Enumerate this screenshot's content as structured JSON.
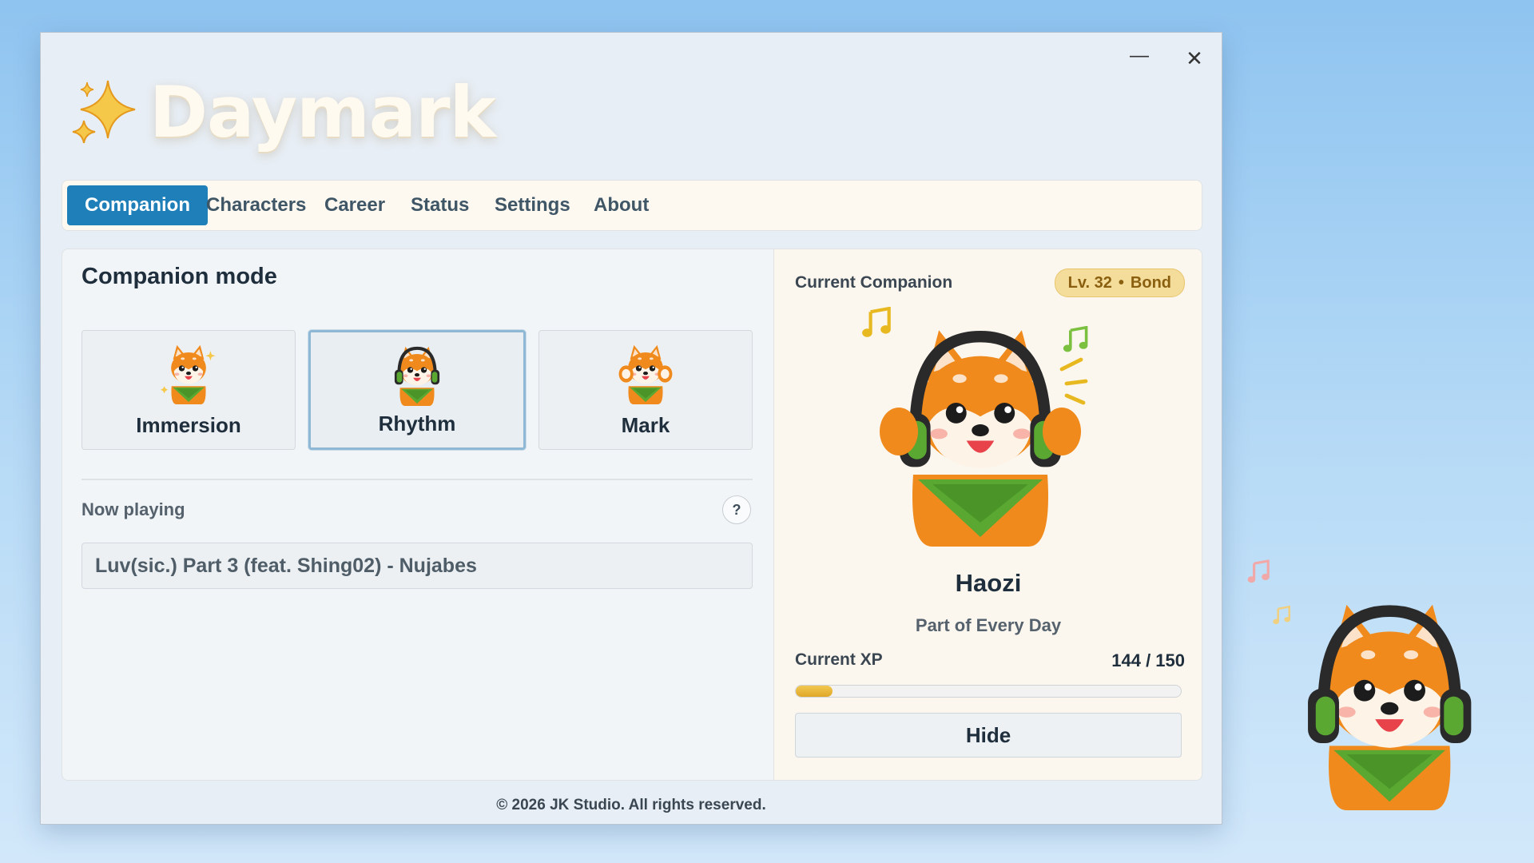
{
  "app": {
    "name": "Daymark"
  },
  "window_controls": {
    "minimize": "—",
    "close": "✕"
  },
  "tabs": [
    {
      "label": "Companion",
      "active": true
    },
    {
      "label": "Characters",
      "active": false
    },
    {
      "label": "Career",
      "active": false
    },
    {
      "label": "Status",
      "active": false
    },
    {
      "label": "Settings",
      "active": false
    },
    {
      "label": "About",
      "active": false
    }
  ],
  "companion_mode": {
    "title": "Companion mode",
    "modes": [
      {
        "label": "Immersion",
        "icon": "shiba-cheer-icon",
        "selected": false
      },
      {
        "label": "Rhythm",
        "icon": "shiba-headphones-icon",
        "selected": true
      },
      {
        "label": "Mark",
        "icon": "shiba-paws-icon",
        "selected": false
      }
    ],
    "now_playing": {
      "label": "Now playing",
      "help": "?",
      "value": "Luv(sic.) Part 3 (feat. Shing02) - Nujabes"
    }
  },
  "current_companion": {
    "label": "Current Companion",
    "level": "Lv. 32",
    "bond": "Bond",
    "name": "Haozi",
    "subtitle": "Part of Every Day",
    "xp_label": "Current XP",
    "xp_text": "144 / 150",
    "xp_fraction": 0.096,
    "hide_label": "Hide"
  },
  "footer": {
    "text": "© 2026 JK Studio. All rights reserved."
  },
  "colors": {
    "accent": "#1f7fb8",
    "badge": "#f4dc9a",
    "xp_fill": "#e0a728",
    "shiba": "#f08a1c",
    "bandana": "#5aa832"
  }
}
